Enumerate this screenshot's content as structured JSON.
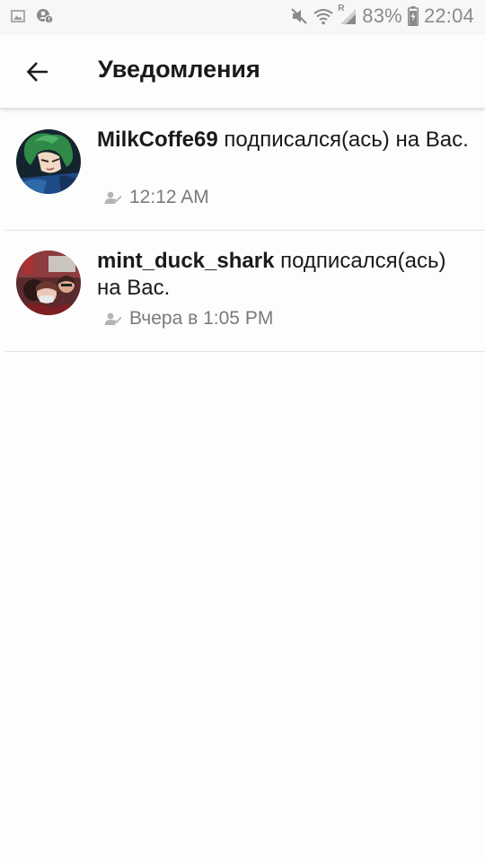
{
  "status_bar": {
    "battery_percent": "83%",
    "time": "22:04",
    "roaming": "R",
    "icons": [
      "image-icon",
      "account-alert-icon",
      "mute-icon",
      "wifi-icon",
      "signal-icon",
      "battery-charging-icon"
    ]
  },
  "header": {
    "title": "Уведомления",
    "back_icon": "arrow-left-icon"
  },
  "notifications": [
    {
      "username": "MilkCoffe69",
      "message": " подписался(ась) на Вас.",
      "time": "12:12 AM",
      "meta_icon": "person-check-icon"
    },
    {
      "username": "mint_duck_shark",
      "message": " подписался(ась) на Вас.",
      "time": "Вчера в 1:05 PM",
      "meta_icon": "person-check-icon"
    }
  ],
  "colors": {
    "background": "#fdfdfd",
    "status_text": "#8a8a8a",
    "meta_text": "#7a7a7a",
    "divider": "#e3e3e3"
  }
}
